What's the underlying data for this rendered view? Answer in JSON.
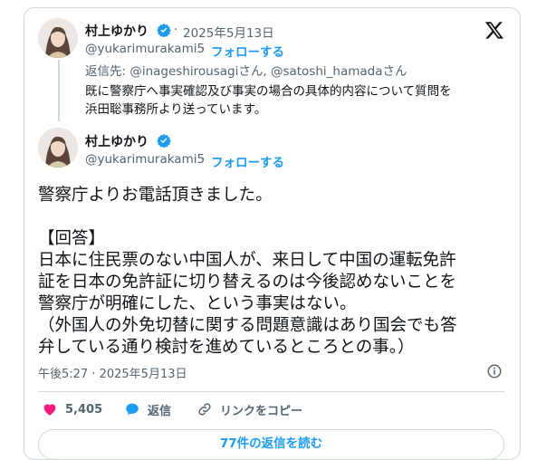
{
  "reply_tweet": {
    "display_name": "村上ゆかり",
    "dot": "·",
    "date": "2025年5月13日",
    "handle": "@yukarimurakami5",
    "separator": "·",
    "follow_label": "フォローする",
    "reply_to_prefix": "返信先: ",
    "reply_to_user1": "@inageshirousagi",
    "reply_to_suffix1": "さん, ",
    "reply_to_user2": "@satoshi_hamada",
    "reply_to_suffix2": "さん",
    "text_lines": [
      "既に警察庁へ事実確認及び事実の場合の具体的内容について質問を",
      "浜田聡事務所より送っています。"
    ]
  },
  "main_tweet": {
    "display_name": "村上ゆかり",
    "handle": "@yukarimurakami5",
    "separator": "·",
    "follow_label": "フォローする",
    "text_lines": [
      "警察庁よりお電話頂きました。",
      "",
      "【回答】",
      "日本に住民票のない中国人が、来日して中国の運転免許",
      "証を日本の免許証に切り替えるのは今後認めないことを",
      "警察庁が明確にした、という事実はない。",
      "（外国人の外免切替に関する問題意識はあり国会でも答",
      "弁している通り検討を進めているところとの事。）"
    ],
    "timestamp": "午後5:27 · 2025年5月13日"
  },
  "actions": {
    "like_count": "5,405",
    "reply_label": "返信",
    "copy_link_label": "リンクをコピー"
  },
  "read_replies_label": "77件の返信を読む",
  "colors": {
    "accent": "#1d9bf0",
    "muted": "#536471",
    "like": "#f91880",
    "text": "#0f1419"
  },
  "icons": [
    "x-logo-icon",
    "verified-badge-icon",
    "heart-icon",
    "reply-bubble-icon",
    "link-icon",
    "info-icon"
  ]
}
